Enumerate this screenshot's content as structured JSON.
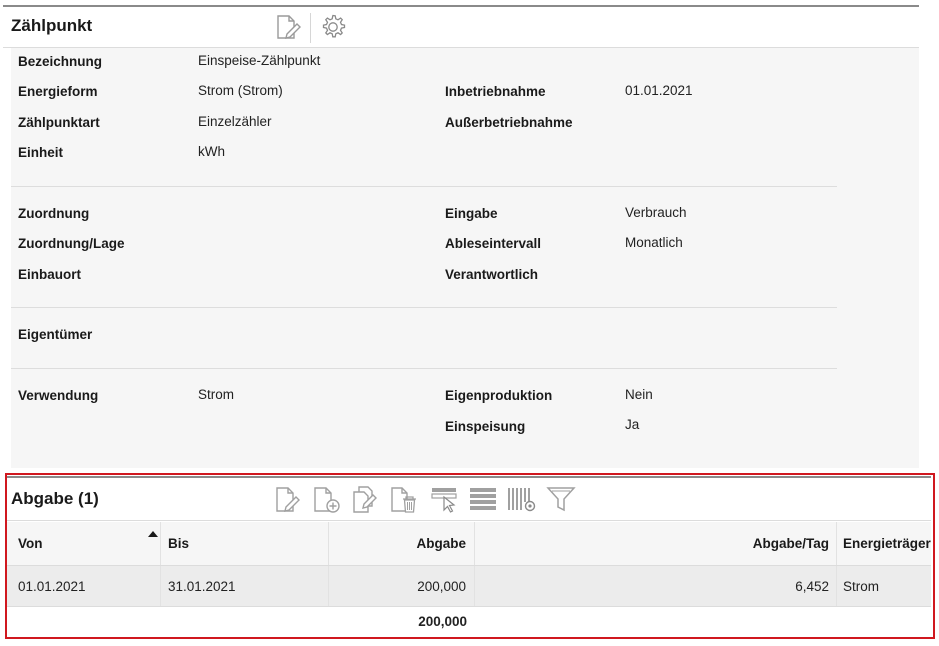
{
  "header": {
    "title": "Zählpunkt",
    "icons": {
      "edit": "edit-document-icon",
      "settings": "gear-icon"
    }
  },
  "details": {
    "bezeichnung": {
      "label": "Bezeichnung",
      "value": "Einspeise-Zählpunkt"
    },
    "energieform": {
      "label": "Energieform",
      "value": "Strom (Strom)"
    },
    "zaehlpunktart": {
      "label": "Zählpunktart",
      "value": "Einzelzähler"
    },
    "einheit": {
      "label": "Einheit",
      "value": "kWh"
    },
    "inbetriebnahme": {
      "label": "Inbetriebnahme",
      "value": "01.01.2021"
    },
    "ausserbetriebnahme": {
      "label": "Außerbetriebnahme",
      "value": ""
    },
    "zuordnung": {
      "label": "Zuordnung",
      "value": ""
    },
    "zuordnung_lage": {
      "label": "Zuordnung/Lage",
      "value": ""
    },
    "einbauort": {
      "label": "Einbauort",
      "value": ""
    },
    "eingabe": {
      "label": "Eingabe",
      "value": "Verbrauch"
    },
    "ableseintervall": {
      "label": "Ableseintervall",
      "value": "Monatlich"
    },
    "verantwortlich": {
      "label": "Verantwortlich",
      "value": ""
    },
    "eigentuemer": {
      "label": "Eigentümer",
      "value": ""
    },
    "verwendung": {
      "label": "Verwendung",
      "value": "Strom"
    },
    "eigenproduktion": {
      "label": "Eigenproduktion",
      "value": "Nein"
    },
    "einspeisung": {
      "label": "Einspeisung",
      "value": "Ja"
    }
  },
  "abgabe": {
    "title": "Abgabe (1)",
    "toolbar_icons": [
      "edit-document-icon",
      "add-document-icon",
      "copy-document-icon",
      "delete-document-icon",
      "select-row-icon",
      "rows-icon",
      "column-settings-icon",
      "filter-icon"
    ],
    "columns": [
      "Von",
      "Bis",
      "Abgabe",
      "Abgabe/Tag",
      "Energieträger"
    ],
    "sort": {
      "column": "Von",
      "direction": "ascending"
    },
    "rows": [
      {
        "von": "01.01.2021",
        "bis": "31.01.2021",
        "abgabe": "200,000",
        "abgabe_tag": "6,452",
        "energietraeger": "Strom"
      }
    ],
    "total": {
      "abgabe": "200,000"
    }
  }
}
